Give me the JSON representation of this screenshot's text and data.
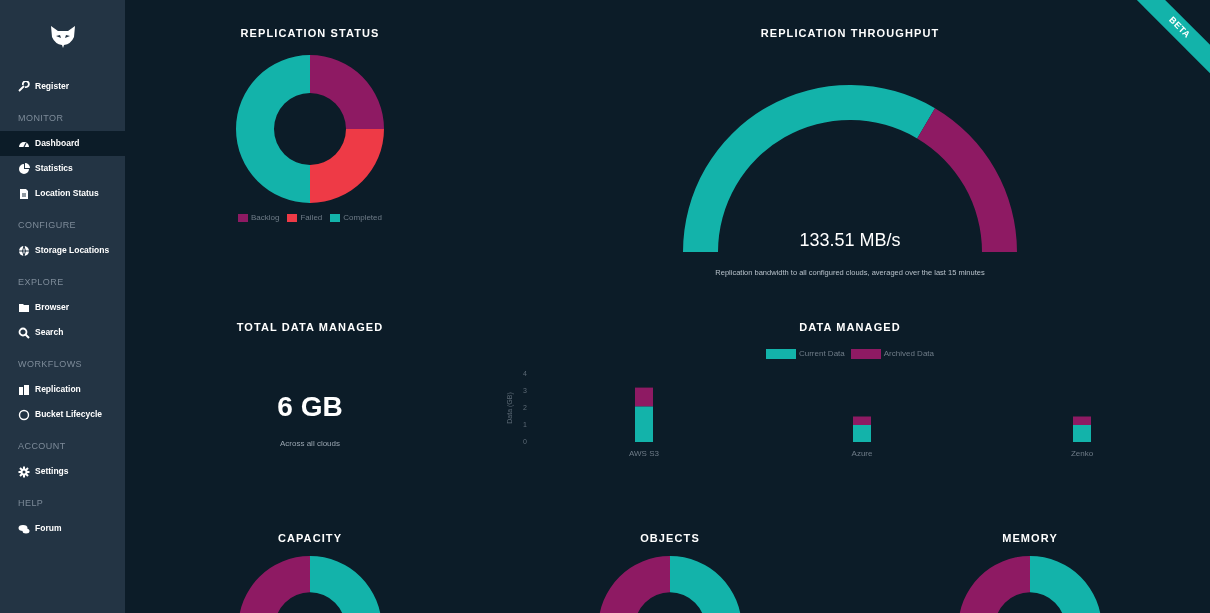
{
  "sidebar": {
    "groups": [
      {
        "items": [
          {
            "label": "Register",
            "selected": false
          }
        ]
      },
      {
        "heading": "MONITOR",
        "items": [
          {
            "label": "Dashboard",
            "selected": true
          },
          {
            "label": "Statistics",
            "selected": false
          },
          {
            "label": "Location Status",
            "selected": false
          }
        ]
      },
      {
        "heading": "CONFIGURE",
        "items": [
          {
            "label": "Storage Locations",
            "selected": false
          }
        ]
      },
      {
        "heading": "EXPLORE",
        "items": [
          {
            "label": "Browser",
            "selected": false
          },
          {
            "label": "Search",
            "selected": false
          }
        ]
      },
      {
        "heading": "WORKFLOWS",
        "items": [
          {
            "label": "Replication",
            "selected": false
          },
          {
            "label": "Bucket Lifecycle",
            "selected": false
          }
        ]
      },
      {
        "heading": "ACCOUNT",
        "items": [
          {
            "label": "Settings",
            "selected": false
          }
        ]
      },
      {
        "heading": "HELP",
        "items": [
          {
            "label": "Forum",
            "selected": false
          }
        ]
      }
    ]
  },
  "ribbon": "BETA",
  "replication_status": {
    "title": "REPLICATION STATUS",
    "segments": [
      {
        "label": "Backlog",
        "color": "#8e1a63"
      },
      {
        "label": "Failed",
        "color": "#ee3a46"
      },
      {
        "label": "Completed",
        "color": "#13b3aa"
      }
    ]
  },
  "replication_throughput": {
    "title": "REPLICATION THROUGHPUT",
    "value": "133.51 MB/s",
    "caption": "Replication bandwidth to all configured clouds, averaged over the last 15 minutes"
  },
  "total_data_managed": {
    "title": "TOTAL DATA MANAGED",
    "value": "6 GB",
    "caption": "Across all clouds"
  },
  "data_managed": {
    "title": "DATA MANAGED",
    "chart_data": {
      "type": "bar",
      "stacked": true,
      "legend": "top",
      "ylabel": "Data (GB)",
      "categories": [
        "AWS S3",
        "Azure",
        "Zenko"
      ],
      "yticks": [
        0,
        1,
        2,
        3,
        4
      ],
      "ylim": [
        0,
        4
      ],
      "series": [
        {
          "name": "Current Data",
          "color": "#13b3aa",
          "values": [
            2.1,
            1.0,
            1.0
          ]
        },
        {
          "name": "Archived Data",
          "color": "#8e1a63",
          "values": [
            1.1,
            0.5,
            0.5
          ]
        }
      ]
    }
  },
  "gauges": [
    {
      "title": "CAPACITY"
    },
    {
      "title": "OBJECTS"
    },
    {
      "title": "MEMORY"
    }
  ]
}
